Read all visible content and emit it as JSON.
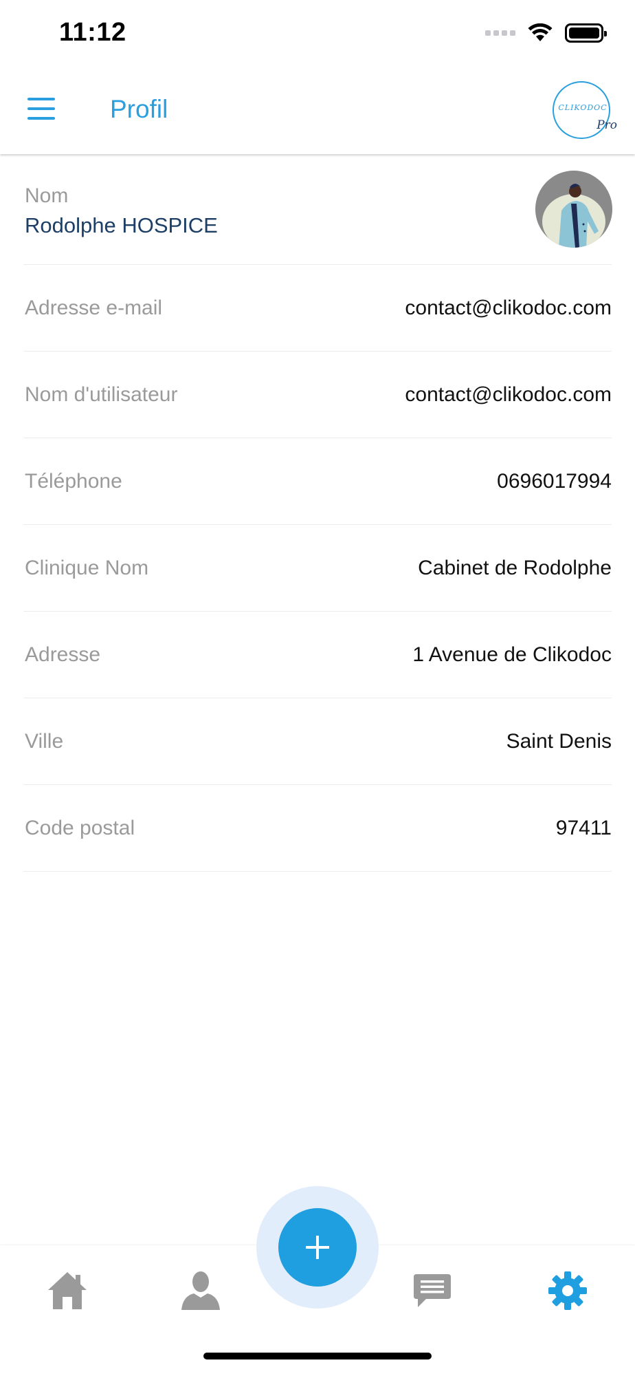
{
  "status_bar": {
    "time": "11:12"
  },
  "header": {
    "title": "Profil",
    "logo_text": "CLIKODOC",
    "logo_suffix": "Pro"
  },
  "profile": {
    "name_label": "Nom",
    "name_value": "Rodolphe HOSPICE",
    "fields": [
      {
        "label": "Adresse e-mail",
        "value": "contact@clikodoc.com"
      },
      {
        "label": "Nom d'utilisateur",
        "value": "contact@clikodoc.com"
      },
      {
        "label": "Téléphone",
        "value": "0696017994"
      },
      {
        "label": "Clinique Nom",
        "value": "Cabinet de Rodolphe"
      },
      {
        "label": "Adresse",
        "value": "1 Avenue de Clikodoc"
      },
      {
        "label": "Ville",
        "value": "Saint Denis"
      },
      {
        "label": "Code postal",
        "value": "97411"
      }
    ]
  },
  "tabbar": {
    "items": [
      {
        "icon": "home-icon"
      },
      {
        "icon": "person-icon"
      },
      {
        "icon": "add-icon"
      },
      {
        "icon": "chat-icon"
      },
      {
        "icon": "gear-icon"
      }
    ],
    "active": "gear-icon"
  },
  "colors": {
    "accent": "#2a9fe0",
    "fab": "#1f9ee0",
    "fab_halo": "#e1edfb",
    "name_text": "#1d3f66",
    "label_text": "#9a9a9a",
    "inactive_icon": "#9a9a9a"
  }
}
